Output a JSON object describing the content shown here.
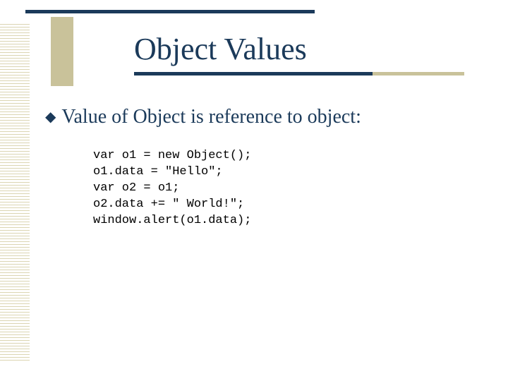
{
  "title": "Object Values",
  "bullet": {
    "marker": "◆",
    "text": "Value of Object is reference to object:"
  },
  "code": {
    "lines": [
      "var o1 = new Object();",
      "o1.data = \"Hello\";",
      "var o2 = o1;",
      "o2.data += \" World!\";",
      "window.alert(o1.data);"
    ]
  },
  "colors": {
    "accent": "#1b3a5a",
    "khaki": "#c9c29a"
  }
}
